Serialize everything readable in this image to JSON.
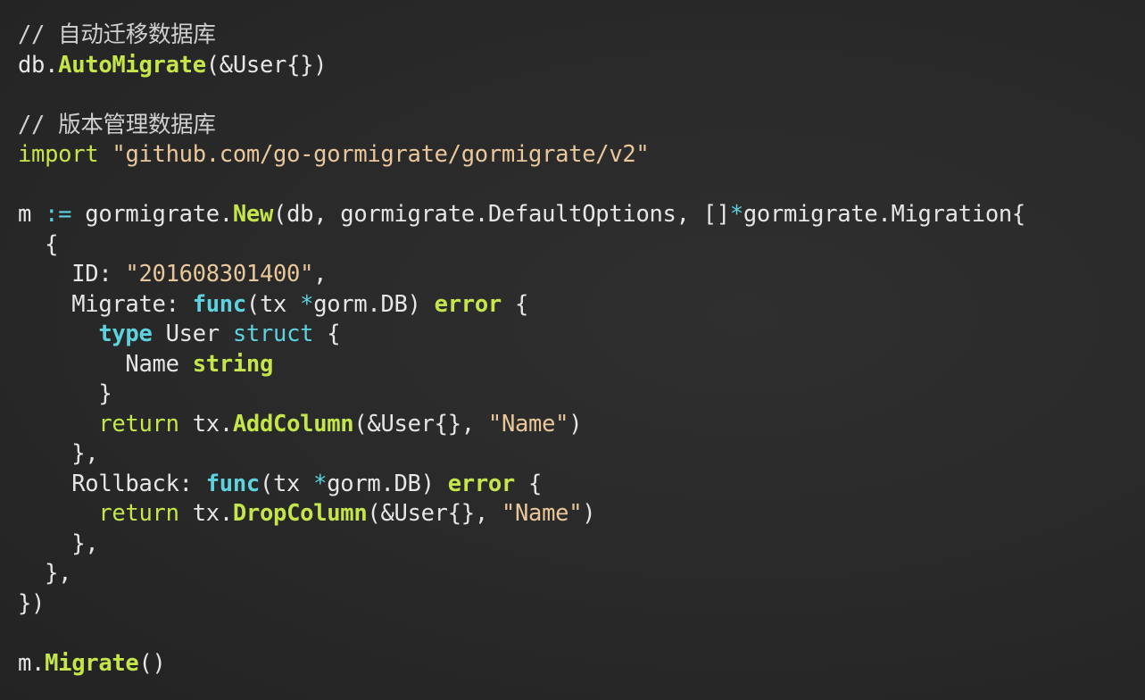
{
  "code": {
    "l1": [
      {
        "t": "// 自动迁移数据库",
        "k": "c"
      }
    ],
    "l2": [
      {
        "t": "db.",
        "k": "p"
      },
      {
        "t": "AutoMigrate",
        "k": "y"
      },
      {
        "t": "(&User{})",
        "k": "p"
      }
    ],
    "l3": [],
    "l4": [
      {
        "t": "// 版本管理数据库",
        "k": "c"
      }
    ],
    "l5": [
      {
        "t": "import",
        "k": "ys"
      },
      {
        "t": " ",
        "k": "p"
      },
      {
        "t": "\"github.com/go-gormigrate/gormigrate/v2\"",
        "k": "s"
      }
    ],
    "l6": [],
    "l7": [
      {
        "t": "m ",
        "k": "p"
      },
      {
        "t": ":=",
        "k": "ts"
      },
      {
        "t": " gormigrate.",
        "k": "p"
      },
      {
        "t": "New",
        "k": "y"
      },
      {
        "t": "(db, gormigrate.DefaultOptions, []",
        "k": "p"
      },
      {
        "t": "*",
        "k": "ts"
      },
      {
        "t": "gormigrate.Migration{",
        "k": "p"
      }
    ],
    "l8": [
      {
        "t": "  {",
        "k": "p"
      }
    ],
    "l9": [
      {
        "t": "    ID: ",
        "k": "p"
      },
      {
        "t": "\"201608301400\"",
        "k": "s"
      },
      {
        "t": ",",
        "k": "p"
      }
    ],
    "l10": [
      {
        "t": "    Migrate: ",
        "k": "p"
      },
      {
        "t": "func",
        "k": "t"
      },
      {
        "t": "(tx ",
        "k": "p"
      },
      {
        "t": "*",
        "k": "ts"
      },
      {
        "t": "gorm.DB) ",
        "k": "p"
      },
      {
        "t": "error",
        "k": "y"
      },
      {
        "t": " {",
        "k": "p"
      }
    ],
    "l11": [
      {
        "t": "      ",
        "k": "p"
      },
      {
        "t": "type",
        "k": "t"
      },
      {
        "t": " User ",
        "k": "p"
      },
      {
        "t": "struct",
        "k": "ts"
      },
      {
        "t": " {",
        "k": "p"
      }
    ],
    "l12": [
      {
        "t": "        Name ",
        "k": "p"
      },
      {
        "t": "string",
        "k": "y"
      }
    ],
    "l13": [
      {
        "t": "      }",
        "k": "p"
      }
    ],
    "l14": [
      {
        "t": "      ",
        "k": "p"
      },
      {
        "t": "return",
        "k": "ys"
      },
      {
        "t": " tx.",
        "k": "p"
      },
      {
        "t": "AddColumn",
        "k": "y"
      },
      {
        "t": "(&User{}, ",
        "k": "p"
      },
      {
        "t": "\"Name\"",
        "k": "s"
      },
      {
        "t": ")",
        "k": "p"
      }
    ],
    "l15": [
      {
        "t": "    },",
        "k": "p"
      }
    ],
    "l16": [
      {
        "t": "    Rollback: ",
        "k": "p"
      },
      {
        "t": "func",
        "k": "t"
      },
      {
        "t": "(tx ",
        "k": "p"
      },
      {
        "t": "*",
        "k": "ts"
      },
      {
        "t": "gorm.DB) ",
        "k": "p"
      },
      {
        "t": "error",
        "k": "y"
      },
      {
        "t": " {",
        "k": "p"
      }
    ],
    "l17": [
      {
        "t": "      ",
        "k": "p"
      },
      {
        "t": "return",
        "k": "ys"
      },
      {
        "t": " tx.",
        "k": "p"
      },
      {
        "t": "DropColumn",
        "k": "y"
      },
      {
        "t": "(&User{}, ",
        "k": "p"
      },
      {
        "t": "\"Name\"",
        "k": "s"
      },
      {
        "t": ")",
        "k": "p"
      }
    ],
    "l18": [
      {
        "t": "    },",
        "k": "p"
      }
    ],
    "l19": [
      {
        "t": "  },",
        "k": "p"
      }
    ],
    "l20": [
      {
        "t": "})",
        "k": "p"
      }
    ],
    "l21": [],
    "l22": [
      {
        "t": "m.",
        "k": "p"
      },
      {
        "t": "Migrate",
        "k": "y"
      },
      {
        "t": "()",
        "k": "p"
      }
    ]
  },
  "colors": {
    "background": "#2a2a2a",
    "comment": "#cfcfcf",
    "function_keyword": "#c5e64a",
    "type_keyword": "#5cd3df",
    "string": "#e9c79b",
    "plain": "#e6e6e6"
  }
}
